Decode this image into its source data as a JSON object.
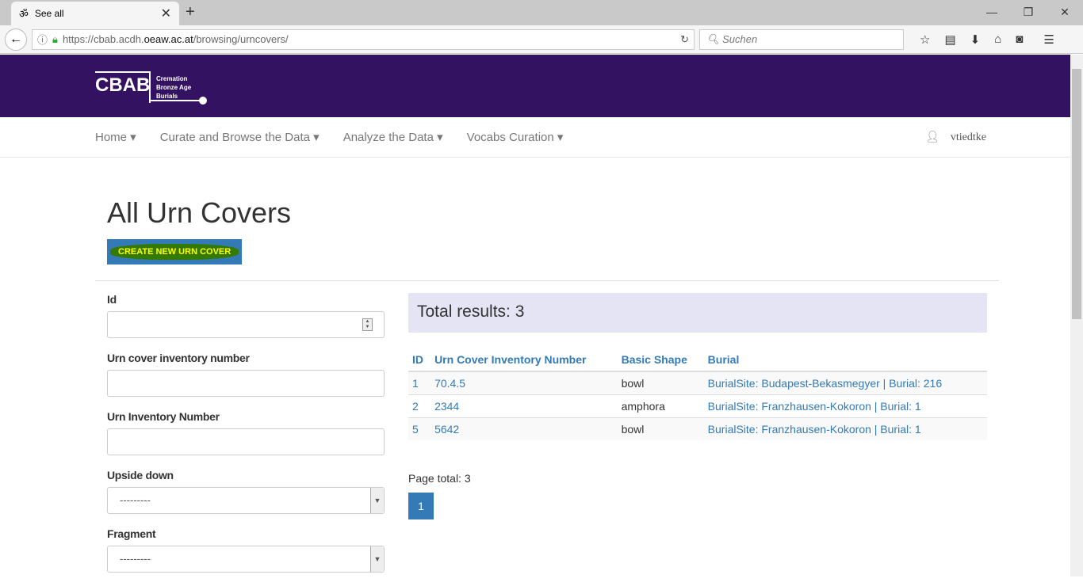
{
  "browser": {
    "tab_title": "See all",
    "url_prefix": "https://cbab.acdh.",
    "url_domain": "oeaw.ac.at",
    "url_path": "/browsing/urncovers/",
    "search_placeholder": "Suchen"
  },
  "logo": {
    "short": "CBAB",
    "line1": "Cremation",
    "line2": "Bronze Age",
    "line3": "Burials"
  },
  "menu": {
    "items": [
      "Home ▾",
      "Curate and Browse the Data ▾",
      "Analyze the Data ▾",
      "Vocabs Curation ▾"
    ],
    "user": "vtiedtke"
  },
  "page": {
    "title": "All Urn Covers",
    "create_label": "CREATE NEW URN COVER"
  },
  "filters": [
    {
      "label": "Id",
      "value": ""
    },
    {
      "label": "Urn cover inventory number",
      "value": ""
    },
    {
      "label": "Urn Inventory Number",
      "value": ""
    },
    {
      "label": "Upside down",
      "value": "---------"
    },
    {
      "label": "Fragment",
      "value": "---------"
    }
  ],
  "results": {
    "total": "Total results: 3",
    "headers": [
      "ID",
      "Urn Cover Inventory Number",
      "Basic Shape",
      "Burial"
    ],
    "rows": [
      [
        "1",
        "70.4.5",
        "bowl",
        "BurialSite: Budapest-Bekasmegyer | Burial: 216"
      ],
      [
        "2",
        "2344",
        "amphora",
        "BurialSite: Franzhausen-Kokoron | Burial: 1"
      ],
      [
        "5",
        "5642",
        "bowl",
        "BurialSite: Franzhausen-Kokoron | Burial: 1"
      ]
    ],
    "page_total": "Page total: 3",
    "current_page": "1"
  }
}
